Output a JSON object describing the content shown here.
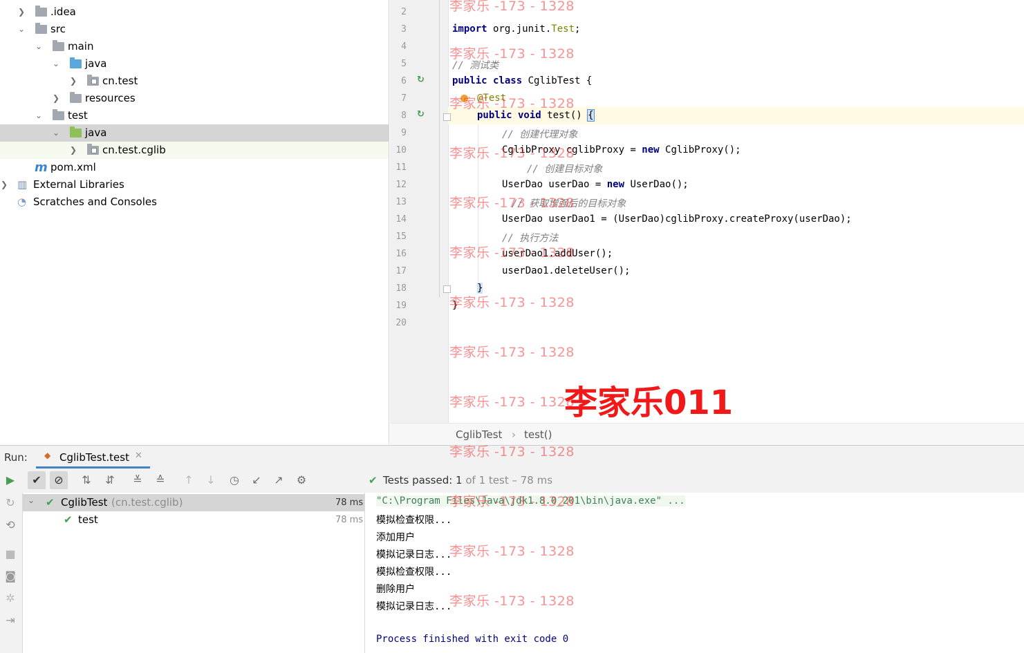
{
  "project_tree": {
    "items": [
      {
        "label": ".idea",
        "depth": 1,
        "chevron": "›"
      },
      {
        "label": "src",
        "depth": 1,
        "chevron": "⌄"
      },
      {
        "label": "main",
        "depth": 2,
        "chevron": "⌄"
      },
      {
        "label": "java",
        "depth": 3,
        "chevron": "⌄"
      },
      {
        "label": "cn.test",
        "depth": 4,
        "chevron": "›"
      },
      {
        "label": "resources",
        "depth": 3,
        "chevron": "›"
      },
      {
        "label": "test",
        "depth": 2,
        "chevron": "⌄"
      },
      {
        "label": "java",
        "depth": 3,
        "chevron": "⌄"
      },
      {
        "label": "cn.test.cglib",
        "depth": 4,
        "chevron": "›"
      },
      {
        "label": "pom.xml",
        "depth": 2,
        "chevron": ""
      },
      {
        "label": "External Libraries",
        "depth": 0,
        "chevron": "›"
      },
      {
        "label": "Scratches and Consoles",
        "depth": 0,
        "chevron": ""
      }
    ]
  },
  "editor": {
    "line_numbers": [
      "2",
      "3",
      "4",
      "5",
      "6",
      "7",
      "8",
      "9",
      "10",
      "11",
      "12",
      "13",
      "14",
      "15",
      "16",
      "17",
      "18",
      "19",
      "20"
    ],
    "code": {
      "l3_kw": "import",
      "l3_rest": " org.junit.",
      "l3_cls": "Test",
      "l3_end": ";",
      "l5": "// 测试类",
      "l6_kw": "public class",
      "l6_rest": " CglibTest {",
      "l7": "@Test",
      "l8_kw": "public void",
      "l8_rest": " test() ",
      "l8_brace": "{",
      "l9": "// 创建代理对象",
      "l10_a": "CglibProxy cglibProxy = ",
      "l10_kw": "new",
      "l10_b": " CglibProxy();",
      "l11": "// 创建目标对象",
      "l12_a": "UserDao userDao = ",
      "l12_kw": "new",
      "l12_b": " UserDao();",
      "l13": "// 获取增强后的目标对象",
      "l14": "UserDao userDao1 = (UserDao)cglibProxy.createProxy(userDao);",
      "l15": "// 执行方法",
      "l16": "userDao1.addUser();",
      "l17": "userDao1.deleteUser();",
      "l18": "}",
      "l19": "}"
    },
    "breadcrumb": {
      "class": "CglibTest",
      "sep": "›",
      "method": "test()"
    }
  },
  "run_panel": {
    "run_label": "Run:",
    "tab_label": "CglibTest.test",
    "status_prefix": "Tests passed: ",
    "status_count": "1",
    "status_suffix": " of 1 test – 78 ms",
    "tests": [
      {
        "name": "CglibTest",
        "pkg": "(cn.test.cglib)",
        "time": "78 ms"
      },
      {
        "name": "test",
        "pkg": "",
        "time": "78 ms"
      }
    ],
    "console": [
      "\"C:\\Program Files\\Java\\jdk1.8.0_201\\bin\\java.exe\" ...",
      "模拟检查权限...",
      "添加用户",
      "模拟记录日志...",
      "模拟检查权限...",
      "删除用户",
      "模拟记录日志...",
      "",
      "Process finished with exit code 0"
    ]
  },
  "watermark": {
    "repeat": "李家乐 -173 - 1328",
    "big": "李家乐011"
  },
  "colors": {
    "keyword": "#000080",
    "comment": "#808080",
    "pass_green": "#499c54",
    "watermark_red": "#f23a3a"
  }
}
